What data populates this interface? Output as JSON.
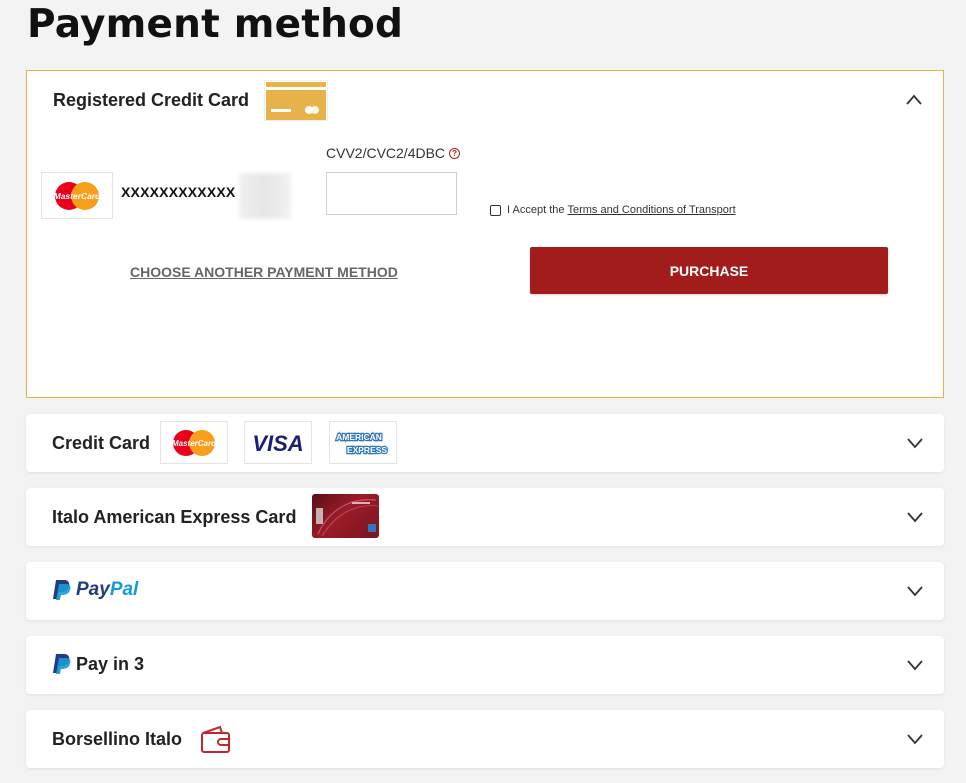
{
  "page_title": "Payment method",
  "registered": {
    "header": "Registered Credit Card",
    "masked_number": "XXXXXXXXXXXX",
    "cvv_label": "CVV2/CVC2/4DBC",
    "cvv_value": "",
    "accept_prefix": "I Accept the",
    "terms_link": "Terms and Conditions of Transport",
    "choose_another": "CHOOSE ANOTHER PAYMENT METHOD",
    "purchase": "PURCHASE"
  },
  "methods": [
    {
      "label": "Credit Card"
    },
    {
      "label": "Italo American Express Card"
    },
    {
      "label": "PayPal"
    },
    {
      "label": "Pay in 3"
    },
    {
      "label": "Borsellino Italo"
    }
  ],
  "logos": {
    "mastercard": "MasterCard",
    "visa": "VISA",
    "amex_line1": "AMERICAN",
    "amex_line2": "EXPRESS",
    "paypal_pay": "Pay",
    "paypal_pal": "Pal"
  },
  "colors": {
    "accent_border": "#e8b24a",
    "purchase_bg": "#a21c1c",
    "mastercard_red": "#eb001b",
    "mastercard_orange": "#f79e1b",
    "visa_blue": "#1a1f71",
    "amex_blue": "#2e77bc",
    "paypal_dark": "#253b80",
    "paypal_light": "#179bd7",
    "wallet_red": "#c0282d"
  }
}
